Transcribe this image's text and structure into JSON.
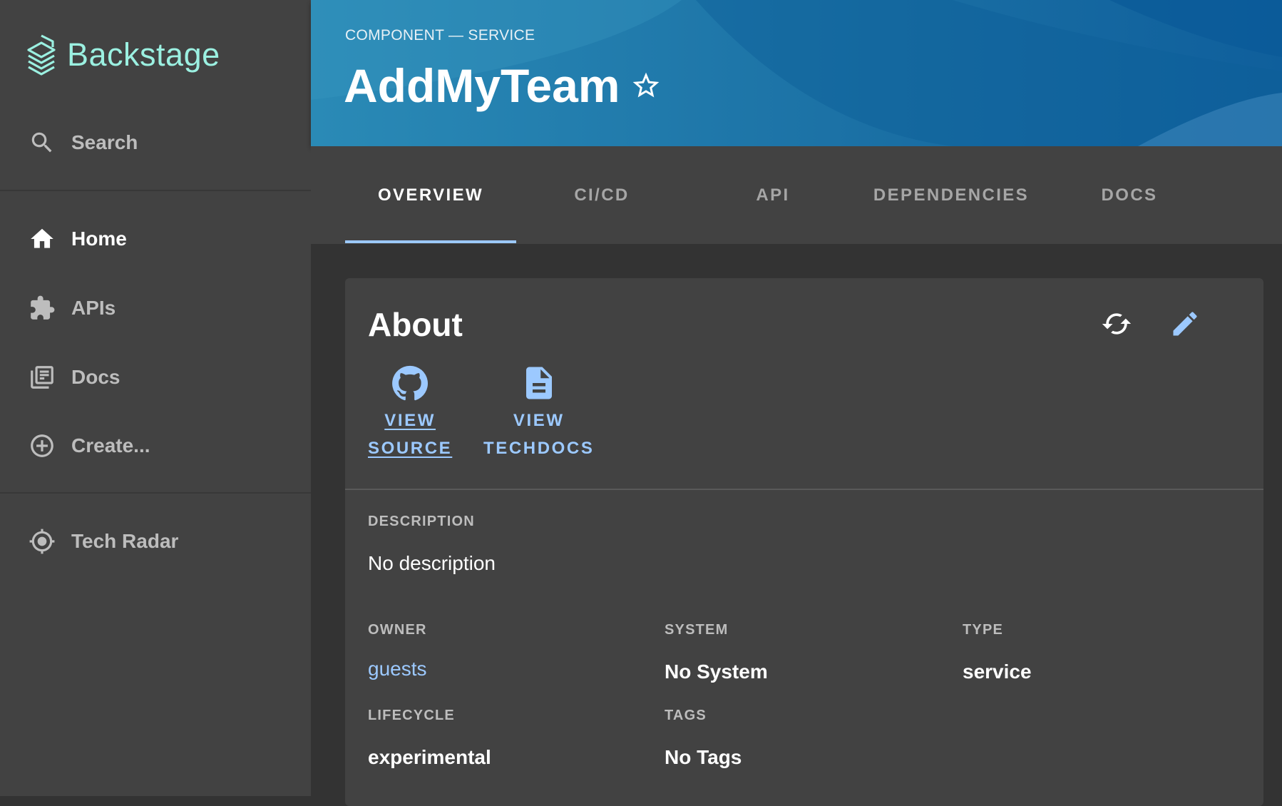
{
  "app": {
    "name": "Backstage",
    "brand_color": "#9BF0E1",
    "accent_color": "#9CC9FF"
  },
  "sidebar": {
    "search": {
      "label": "Search",
      "icon": "search-icon"
    },
    "items": [
      {
        "label": "Home",
        "icon": "home-icon",
        "active": true
      },
      {
        "label": "APIs",
        "icon": "extension-icon"
      },
      {
        "label": "Docs",
        "icon": "library-books-icon"
      },
      {
        "label": "Create...",
        "icon": "add-circle-icon"
      }
    ],
    "plugins": [
      {
        "label": "Tech Radar",
        "icon": "radar-icon"
      }
    ]
  },
  "header": {
    "breadcrumb": "COMPONENT — SERVICE",
    "title": "AddMyTeam",
    "star_icon": "star-outline-icon"
  },
  "tabs": [
    {
      "label": "OVERVIEW",
      "active": true
    },
    {
      "label": "CI/CD"
    },
    {
      "label": "API"
    },
    {
      "label": "DEPENDENCIES"
    },
    {
      "label": "DOCS"
    }
  ],
  "about": {
    "title": "About",
    "refresh_icon": "refresh-icon",
    "edit_icon": "edit-icon",
    "links": [
      {
        "line1": "VIEW",
        "line2": "SOURCE",
        "icon": "github-icon"
      },
      {
        "line1": "VIEW",
        "line2": "TECHDOCS",
        "icon": "document-icon"
      }
    ],
    "description": {
      "label": "DESCRIPTION",
      "value": "No description"
    },
    "owner": {
      "label": "OWNER",
      "value": "guests"
    },
    "system": {
      "label": "SYSTEM",
      "value": "No System"
    },
    "type": {
      "label": "TYPE",
      "value": "service"
    },
    "lifecycle": {
      "label": "LIFECYCLE",
      "value": "experimental"
    },
    "tags": {
      "label": "TAGS",
      "value": "No Tags"
    }
  }
}
